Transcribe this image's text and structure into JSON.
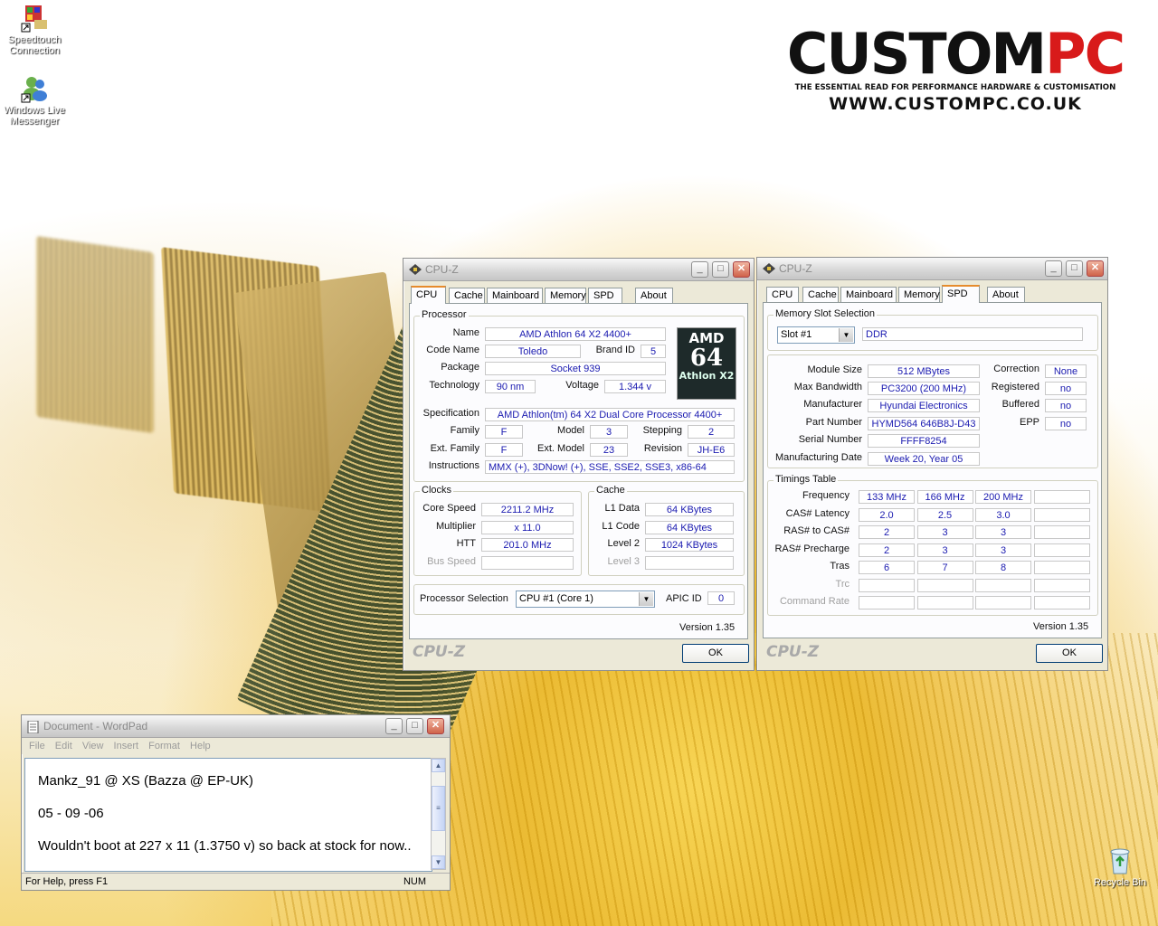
{
  "desktop": {
    "icons": [
      {
        "label": "Speedtouch Connection"
      },
      {
        "label": "Windows Live Messenger"
      },
      {
        "label": "Recycle Bin"
      }
    ],
    "logo": {
      "main_black": "CUSTOM",
      "main_red": "PC",
      "tagline": "THE ESSENTIAL READ FOR PERFORMANCE HARDWARE & CUSTOMISATION",
      "url": "WWW.CUSTOMPC.CO.UK"
    }
  },
  "cpuz_cpu": {
    "title": "CPU-Z",
    "tabs": [
      "CPU",
      "Cache",
      "Mainboard",
      "Memory",
      "SPD",
      "About"
    ],
    "active_tab": "CPU",
    "processor": {
      "group": "Processor",
      "name_label": "Name",
      "name": "AMD Athlon 64 X2 4400+",
      "codename_label": "Code Name",
      "codename": "Toledo",
      "brandid_label": "Brand ID",
      "brandid": "5",
      "package_label": "Package",
      "package": "Socket 939",
      "technology_label": "Technology",
      "technology": "90 nm",
      "voltage_label": "Voltage",
      "voltage": "1.344 v",
      "spec_label": "Specification",
      "spec": "AMD Athlon(tm) 64 X2 Dual Core Processor 4400+",
      "family_label": "Family",
      "family": "F",
      "model_label": "Model",
      "model": "3",
      "stepping_label": "Stepping",
      "stepping": "2",
      "extfamily_label": "Ext. Family",
      "extfamily": "F",
      "extmodel_label": "Ext. Model",
      "extmodel": "23",
      "revision_label": "Revision",
      "revision": "JH-E6",
      "instructions_label": "Instructions",
      "instructions": "MMX (+), 3DNow! (+), SSE, SSE2, SSE3, x86-64",
      "logo_amd": "AMD",
      "logo_64": "64",
      "logo_athlon": "Athlon X2"
    },
    "clocks": {
      "group": "Clocks",
      "corespeed_label": "Core Speed",
      "corespeed": "2211.2 MHz",
      "multiplier_label": "Multiplier",
      "multiplier": "x 11.0",
      "htt_label": "HTT",
      "htt": "201.0 MHz",
      "busspeed_label": "Bus Speed",
      "busspeed": ""
    },
    "cache": {
      "group": "Cache",
      "l1data_label": "L1 Data",
      "l1data": "64 KBytes",
      "l1code_label": "L1 Code",
      "l1code": "64 KBytes",
      "level2_label": "Level 2",
      "level2": "1024 KBytes",
      "level3_label": "Level 3",
      "level3": ""
    },
    "selection": {
      "label": "Processor Selection",
      "value": "CPU #1 (Core 1)",
      "apic_label": "APIC ID",
      "apic": "0"
    },
    "version": "Version 1.35",
    "brand": "CPU-Z",
    "ok": "OK"
  },
  "cpuz_spd": {
    "title": "CPU-Z",
    "tabs": [
      "CPU",
      "Cache",
      "Mainboard",
      "Memory",
      "SPD",
      "About"
    ],
    "active_tab": "SPD",
    "slot": {
      "group": "Memory Slot Selection",
      "selected": "Slot #1",
      "type": "DDR"
    },
    "module": {
      "size_label": "Module Size",
      "size": "512 MBytes",
      "bandwidth_label": "Max Bandwidth",
      "bandwidth": "PC3200 (200 MHz)",
      "manufacturer_label": "Manufacturer",
      "manufacturer": "Hyundai Electronics",
      "part_label": "Part Number",
      "part": "HYMD564 646B8J-D43",
      "serial_label": "Serial Number",
      "serial": "FFFF8254",
      "date_label": "Manufacturing Date",
      "date": "Week 20, Year 05",
      "correction_label": "Correction",
      "correction": "None",
      "registered_label": "Registered",
      "registered": "no",
      "buffered_label": "Buffered",
      "buffered": "no",
      "epp_label": "EPP",
      "epp": "no"
    },
    "timings": {
      "group": "Timings Table",
      "rows": [
        {
          "label": "Frequency",
          "values": [
            "133 MHz",
            "166 MHz",
            "200 MHz",
            ""
          ]
        },
        {
          "label": "CAS# Latency",
          "values": [
            "2.0",
            "2.5",
            "3.0",
            ""
          ]
        },
        {
          "label": "RAS# to CAS#",
          "values": [
            "2",
            "3",
            "3",
            ""
          ]
        },
        {
          "label": "RAS# Precharge",
          "values": [
            "2",
            "3",
            "3",
            ""
          ]
        },
        {
          "label": "Tras",
          "values": [
            "6",
            "7",
            "8",
            ""
          ]
        },
        {
          "label": "Trc",
          "values": [
            "",
            "",
            "",
            ""
          ]
        },
        {
          "label": "Command Rate",
          "values": [
            "",
            "",
            "",
            ""
          ]
        }
      ]
    },
    "version": "Version 1.35",
    "brand": "CPU-Z",
    "ok": "OK"
  },
  "wordpad": {
    "title": "Document - WordPad",
    "menu": [
      "File",
      "Edit",
      "View",
      "Insert",
      "Format",
      "Help"
    ],
    "lines": [
      "Mankz_91 @ XS          (Bazza @ EP-UK)",
      "05 - 09 -06",
      "Wouldn't boot at 227 x 11 (1.3750 v)  so back at stock for now.."
    ],
    "status_left": "For Help, press F1",
    "status_right": "NUM"
  }
}
